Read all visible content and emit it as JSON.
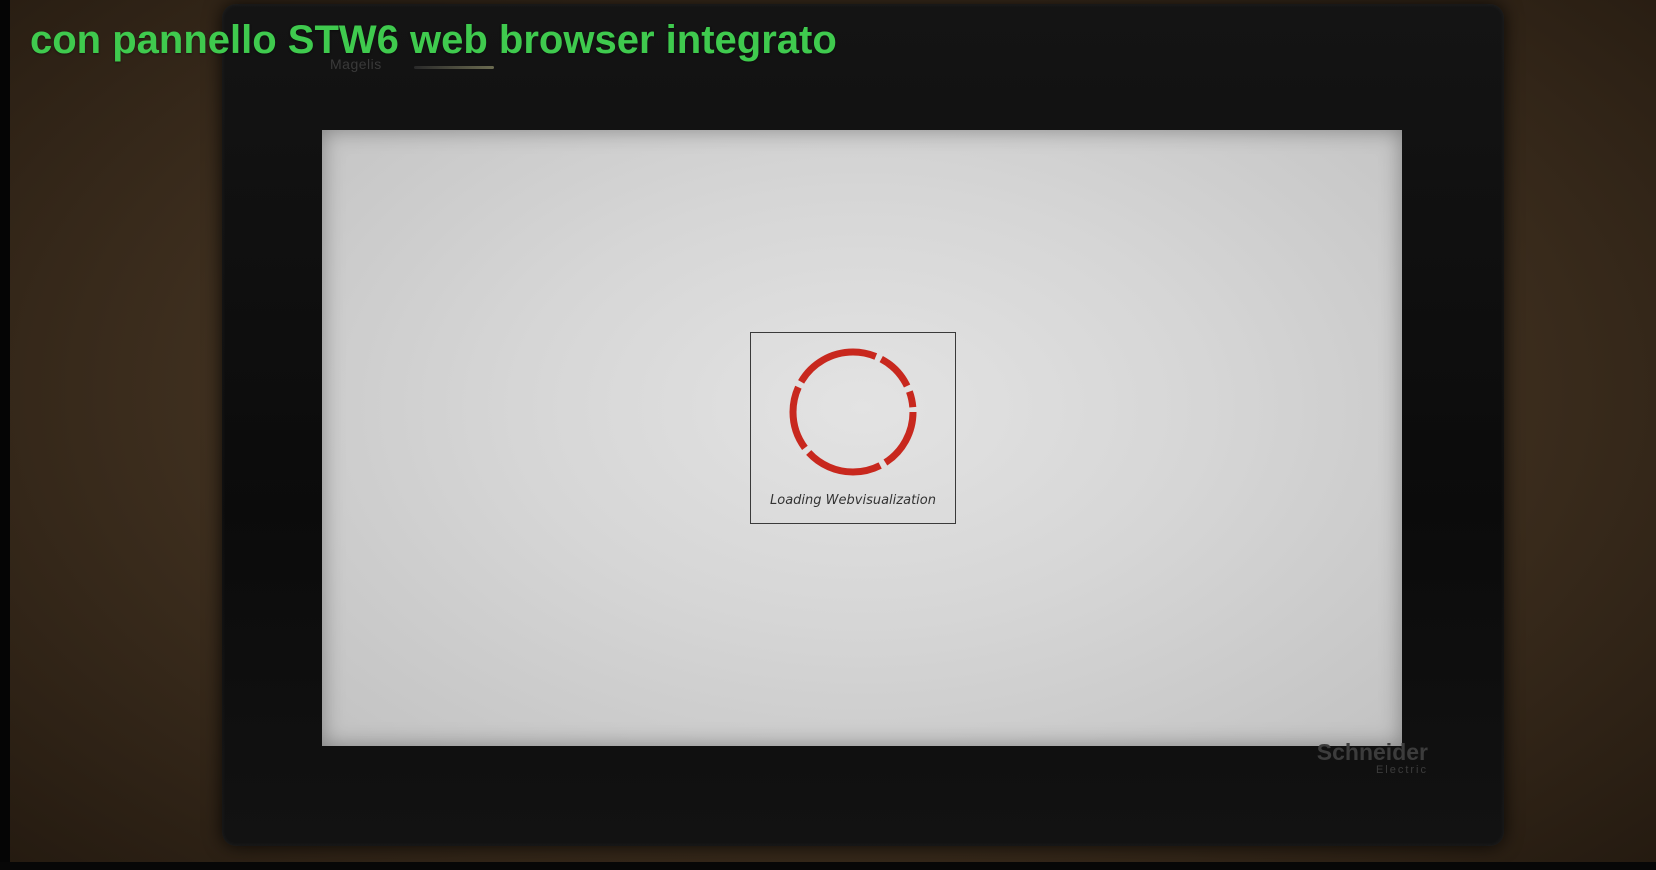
{
  "caption": {
    "text": "con pannello STW6 web browser integrato",
    "color": "#3fca4e"
  },
  "panel": {
    "model_text": "Magelis",
    "brand": "Schneider",
    "brand_sub": "Electric"
  },
  "screen": {
    "loading_text": "Loading Webvisualization",
    "spinner_color": "#c8281e",
    "background": "#d9d9d9"
  }
}
